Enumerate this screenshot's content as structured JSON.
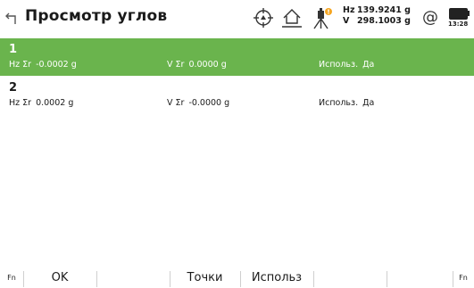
{
  "header": {
    "title": "Просмотр углов",
    "hz_label": "Hz",
    "hz_value": "139.9241 g",
    "v_label": "V",
    "v_value": "298.1003 g",
    "at_symbol": "@",
    "time": "13:28",
    "icons": [
      "back-arrow-icon",
      "target-prism-icon",
      "station-home-icon",
      "instrument-icon",
      "at-icon",
      "battery-icon"
    ],
    "warning_color": "#f5a623"
  },
  "rows": [
    {
      "num": "1",
      "hz_label": "Hz Σr",
      "hz_value": "-0.0002 g",
      "v_label": "V Σr",
      "v_value": "0.0000 g",
      "use_label": "Использ.",
      "use_value": "Да"
    },
    {
      "num": "2",
      "hz_label": "Hz Σr",
      "hz_value": "0.0002 g",
      "v_label": "V Σr",
      "v_value": "-0.0000 g",
      "use_label": "Использ.",
      "use_value": "Да"
    }
  ],
  "colors": {
    "selected_row": "#6ab44d"
  },
  "softkeys": {
    "fn_left": "Fn",
    "ok": "OK",
    "points": "Точки",
    "use": "Использ",
    "fn_right": "Fn"
  }
}
